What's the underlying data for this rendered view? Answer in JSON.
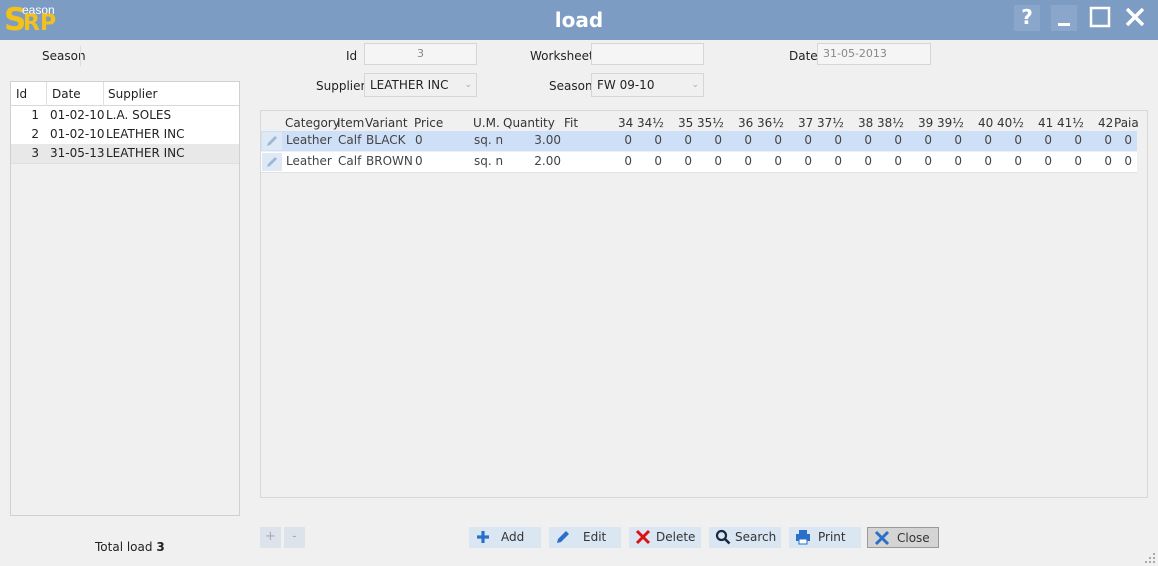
{
  "window": {
    "title": "load",
    "logo_small": "eason",
    "logo_s": "S",
    "logo_rp": "RP"
  },
  "form": {
    "season_label": "Season",
    "id_label": "Id",
    "id_value": "3",
    "worksheet_label": "Worksheet",
    "worksheet_value": "",
    "date_label": "Date",
    "date_value": "31-05-2013",
    "supplier_label": "Supplier",
    "supplier_value": "LEATHER INC",
    "season2_label": "Season",
    "season2_value": "FW 09-10"
  },
  "list": {
    "headers": [
      "Id",
      "Date",
      "Supplier"
    ],
    "rows": [
      [
        "1",
        "01-02-10",
        "L.A. SOLES"
      ],
      [
        "2",
        "01-02-10",
        "LEATHER INC"
      ],
      [
        "3",
        "31-05-13",
        "LEATHER INC"
      ]
    ]
  },
  "grid": {
    "headers": [
      "Category",
      "Item",
      "Variant",
      "Price",
      "U.M.",
      "Quantity",
      "Fit",
      "34",
      "34½",
      "35",
      "35½",
      "36",
      "36½",
      "37",
      "37½",
      "38",
      "38½",
      "39",
      "39½",
      "40",
      "40½",
      "41",
      "41½",
      "42",
      "Paia"
    ],
    "rows": [
      [
        "Leather",
        "Calf",
        "BLACK",
        "0",
        "sq. n",
        "3.00",
        "",
        "0",
        "0",
        "0",
        "0",
        "0",
        "0",
        "0",
        "0",
        "0",
        "0",
        "0",
        "0",
        "0",
        "0",
        "0",
        "0",
        "0",
        "0"
      ],
      [
        "Leather",
        "Calf",
        "BROWN",
        "0",
        "sq. n",
        "2.00",
        "",
        "0",
        "0",
        "0",
        "0",
        "0",
        "0",
        "0",
        "0",
        "0",
        "0",
        "0",
        "0",
        "0",
        "0",
        "0",
        "0",
        "0",
        "0"
      ]
    ]
  },
  "footer": {
    "total_label": "Total load",
    "total_value": "3",
    "plus": "+",
    "minus": "-",
    "add": "Add",
    "edit": "Edit",
    "delete": "Delete",
    "search": "Search",
    "print": "Print",
    "close": "Close"
  },
  "colors": {
    "titlebar": "#7c9cc4",
    "logo": "#f2c21b",
    "selected_row": "#cde0f7",
    "button": "#dbe6f3"
  }
}
